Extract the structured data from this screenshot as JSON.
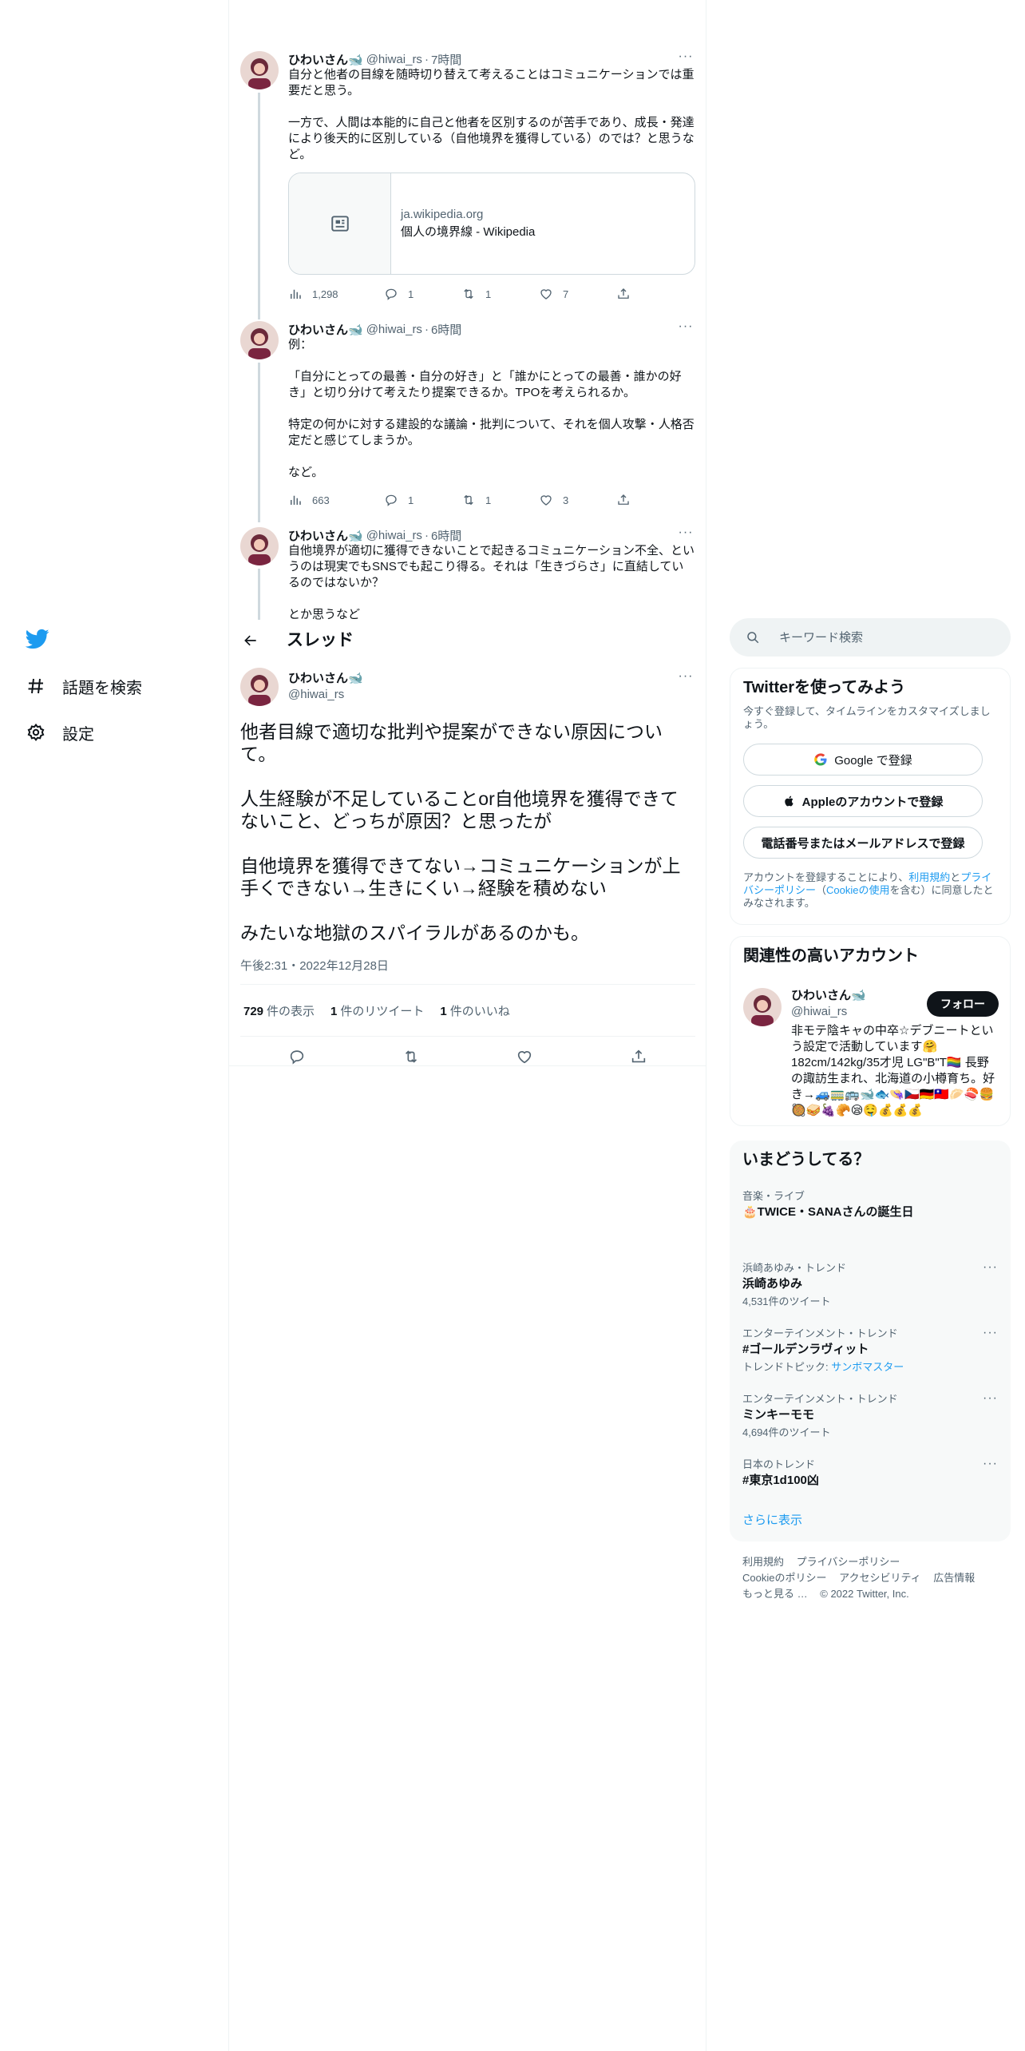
{
  "nav": {
    "items": [
      {
        "label": "話題を検索"
      },
      {
        "label": "設定"
      }
    ]
  },
  "thread_tweets": [
    {
      "name": "ひわいさん🐋",
      "handle": "@hiwai_rs",
      "time": "7時間",
      "text": "自分と他者の目線を随時切り替えて考えることはコミュニケーションでは重要だと思う。\n\n一方で、人間は本能的に自己と他者を区別するのが苦手であり、成長・発達により後天的に区別している（自他境界を獲得している）のでは？と思うなど。",
      "card": {
        "domain": "ja.wikipedia.org",
        "title": "個人の境界線 - Wikipedia"
      },
      "views": "1,298",
      "replies": "1",
      "retweets": "1",
      "likes": "7"
    },
    {
      "name": "ひわいさん🐋",
      "handle": "@hiwai_rs",
      "time": "6時間",
      "text": "例：\n\n「自分にとっての最善・自分の好き」と「誰かにとっての最善・誰かの好き」と切り分けて考えたり提案できるか。TPOを考えられるか。\n\n特定の何かに対する建設的な議論・批判について、それを個人攻撃・人格否定だと感じてしまうか。\n\nなど。",
      "views": "663",
      "replies": "1",
      "retweets": "1",
      "likes": "3"
    },
    {
      "name": "ひわいさん🐋",
      "handle": "@hiwai_rs",
      "time": "6時間",
      "text": "自他境界が適切に獲得できないことで起きるコミュニケーション不全、というのは現実でもSNSでも起こり得る。それは「生きづらさ」に直結しているのではないか？\n\nとか思うなど"
    }
  ],
  "header": {
    "title": "スレッド"
  },
  "main_tweet": {
    "name": "ひわいさん🐋",
    "handle": "@hiwai_rs",
    "text": "他者目線で適切な批判や提案ができない原因について。\n\n人生経験が不足していることor自他境界を獲得できてないこと、どっちが原因？と思ったが\n\n自他境界を獲得できてない→コミュニケーションが上手くできない→生きにくい→経験を積めない\n\nみたいな地獄のスパイラルがあるのかも。",
    "date": "午後2:31・2022年12月28日",
    "views": "729",
    "views_label": "件の表示",
    "retweets": "1",
    "retweets_label": "件のリツイート",
    "likes": "1",
    "likes_label": "件のいいね"
  },
  "search": {
    "placeholder": "キーワード検索"
  },
  "signup": {
    "title": "Twitterを使ってみよう",
    "subtitle": "今すぐ登録して、タイムラインをカスタマイズしましょう。",
    "google_label": "Google で登録",
    "apple_label": "Appleのアカウントで登録",
    "phone_label": "電話番号またはメールアドレスで登録",
    "terms_prefix": "アカウントを登録することにより、",
    "terms_link": "利用規約",
    "terms_and": "と",
    "privacy_link": "プライバシーポリシー",
    "terms_paren_open": "（",
    "cookie_link": "Cookieの使用",
    "terms_suffix": "を含む）に同意したとみなされます。"
  },
  "related": {
    "title": "関連性の高いアカウント",
    "name": "ひわいさん🐋",
    "handle": "@hiwai_rs",
    "follow_label": "フォロー",
    "bio": "非モテ陰キャの中卒☆デブニートという設定で活動しています🤗 182cm/142kg/35才児 LG\"B\"T🏳️‍🌈 長野の諏訪生まれ、北海道の小樽育ち。好き→🚙🚃🚌🐋🐟👒🇨🇿🇩🇪🇹🇼🥟🍣🍔🥘🥪🍇🥐😪🤤💰💰💰"
  },
  "trends": {
    "title": "いまどうしてる？",
    "items": [
      {
        "meta": "音楽・ライブ",
        "name": "🎂TWICE・SANAさんの誕生日",
        "sub": ""
      },
      {
        "meta": "浜崎あゆみ・トレンド",
        "name": "浜崎あゆみ",
        "sub": "4,531件のツイート"
      },
      {
        "meta": "エンターテインメント・トレンド",
        "name": "#ゴールデンラヴィット",
        "sub_prefix": "トレンドトピック: ",
        "sub_link": "サンボマスター"
      },
      {
        "meta": "エンターテインメント・トレンド",
        "name": "ミンキーモモ",
        "sub": "4,694件のツイート"
      },
      {
        "meta": "日本のトレンド",
        "name": "#東京1d100凶",
        "sub": ""
      }
    ],
    "show_more": "さらに表示"
  },
  "footer": {
    "links": [
      "利用規約",
      "プライバシーポリシー",
      "Cookieのポリシー",
      "アクセシビリティ",
      "広告情報",
      "もっと見る …"
    ],
    "copyright": "© 2022 Twitter, Inc."
  },
  "colors": {
    "accent": "#1d9bf0",
    "text": "#0f1419",
    "secondary": "#536471",
    "border": "#eff3f4"
  }
}
